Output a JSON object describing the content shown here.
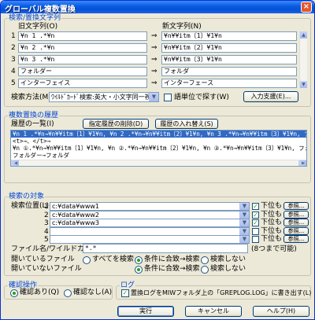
{
  "window": {
    "title": "グローバル複数置換",
    "close": "×"
  },
  "search_replace": {
    "group_title": "検索/置換文字列",
    "old_header": "旧文字列(O)",
    "new_header": "新文字列(N)",
    "rows": [
      {
        "num": "1",
        "old": "¥n 1 .*¥n",
        "new": "¥n¥¥itm〔1〕¥1¥n"
      },
      {
        "num": "2",
        "old": "¥n 2 .*¥n",
        "new": "¥n¥¥itm〔2〕¥1¥n"
      },
      {
        "num": "3",
        "old": "¥n 3 .*¥n",
        "new": "¥n¥¥itm〔3〕¥1¥n"
      },
      {
        "num": "4",
        "old": "フォルダー",
        "new": "フォルダ"
      },
      {
        "num": "5",
        "old": "インターフェイス",
        "new": "インターフェース"
      }
    ],
    "arrow": "⇒",
    "method_label": "検索方法(M)",
    "method_value": "ﾜｲﾙﾄﾞｶｰﾄﾞ検索:英大・小文字同一視",
    "word_unit_label": "語単位で探す(W)",
    "input_assist_button": "入力支援(E)..."
  },
  "history": {
    "group_title": "複数置換の履歴",
    "list_label": "履歴の一覧(I)",
    "delete_button": "指定履歴の削除(D)",
    "swap_button": "履歴の入れ替え(S)",
    "lines": [
      "¥n 1 .*¥n→¥n¥¥itm〔1〕¥1¥n, ¥n 2 .*¥n→¥n¥¥itm〔2〕¥1¥n, ¥n 3 .*¥n→¥n¥¥itm〔3〕¥1¥n, フォルダー",
      "<t>→、</t>→",
      "¥n ①.*¥n→¥n¥¥itm〔1〕¥1¥n, ¥n ②.*¥n→¥n¥¥itm〔2〕¥1¥n, ¥n ③.*¥n→¥n¥¥itm〔3〕¥1¥n, フォルダ",
      "フォルダー→フォルダ"
    ]
  },
  "targets": {
    "group_title": "検索の対象",
    "location_label": "検索位置(L)",
    "rows": [
      {
        "num": "1",
        "path": "c:¥data¥www1",
        "subfolder": "下位も",
        "checked": true,
        "browse": "参照..."
      },
      {
        "num": "2",
        "path": "c:¥data¥www2",
        "subfolder": "下位も",
        "checked": true,
        "browse": "参照..."
      },
      {
        "num": "3",
        "path": "c:¥data¥www3",
        "subfolder": "下位も",
        "checked": true,
        "browse": "参照..."
      },
      {
        "num": "4",
        "path": "",
        "subfolder": "下位も",
        "checked": false,
        "browse": "参照..."
      },
      {
        "num": "5",
        "path": "",
        "subfolder": "下位も",
        "checked": false,
        "browse": "参照..."
      }
    ],
    "filename_label": "ファイル名/ワイルドカード",
    "filename_value": "*.*",
    "filename_hint": "(8つまで可能)",
    "open_files_label": "開いているファイル",
    "closed_files_label": "開いていないファイル",
    "opt_all": "すべてを検索",
    "opt_match": "条件に合致→検索",
    "opt_none": "検索しない"
  },
  "confirm": {
    "group_title": "確認操作",
    "yes": "確認あり(Q)",
    "no": "確認なし(A)"
  },
  "log": {
    "group_title": "ログ",
    "checkbox_label": "置換ログをMIWフォルダ上の「GREPLOG.LOG」に書き出す(L)"
  },
  "buttons": {
    "run": "実行",
    "cancel": "キャンセル",
    "help": "ヘルプ(H)"
  }
}
